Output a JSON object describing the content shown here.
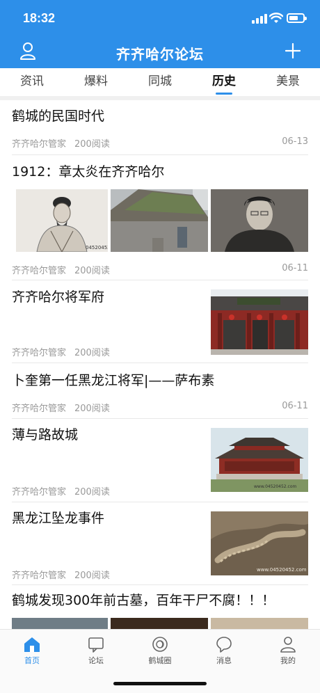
{
  "status_bar": {
    "time": "18:32"
  },
  "nav": {
    "title": "齐齐哈尔论坛"
  },
  "tabs": [
    {
      "label": "资讯"
    },
    {
      "label": "爆料"
    },
    {
      "label": "同城"
    },
    {
      "label": "历史",
      "active": true
    },
    {
      "label": "美景"
    }
  ],
  "feed": [
    {
      "title": "鹤城的民国时代",
      "author": "齐齐哈尔管家",
      "reads": "200阅读",
      "date": "06-13"
    },
    {
      "title": "1912：章太炎在齐齐哈尔",
      "author": "齐齐哈尔管家",
      "reads": "200阅读",
      "date": "06-11",
      "images": [
        "portrait-of-zhang-taiyan-sketch",
        "old-house-roof-photo",
        "portrait-young-man-photo"
      ]
    },
    {
      "title": "齐齐哈尔将军府",
      "author": "齐齐哈尔管家",
      "reads": "200阅读",
      "image": "general-mansion-gate-photo"
    },
    {
      "title": "卜奎第一任黑龙江将军|——萨布素",
      "author": "齐齐哈尔管家",
      "reads": "200阅读",
      "date": "06-11"
    },
    {
      "title": "薄与路故城",
      "author": "齐齐哈尔管家",
      "reads": "200阅读",
      "image": "ancient-temple-photo",
      "image_watermark": "www.04520452.com"
    },
    {
      "title": "黑龙江坠龙事件",
      "author": "齐齐哈尔管家",
      "reads": "200阅读",
      "image": "dragon-fossil-photo",
      "image_watermark": "www.04520452.com"
    },
    {
      "title": "鹤城发现300年前古墓，百年干尸不腐！！！"
    }
  ],
  "tabbar": [
    {
      "label": "首页",
      "icon": "home-icon",
      "active": true
    },
    {
      "label": "论坛",
      "icon": "forum-icon"
    },
    {
      "label": "鹤城圈",
      "icon": "circle-icon"
    },
    {
      "label": "消息",
      "icon": "message-icon"
    },
    {
      "label": "我的",
      "icon": "profile-icon"
    }
  ],
  "colors": {
    "primary": "#2d8fe9",
    "meta_text": "#999999",
    "divider": "#e8e8e8"
  }
}
